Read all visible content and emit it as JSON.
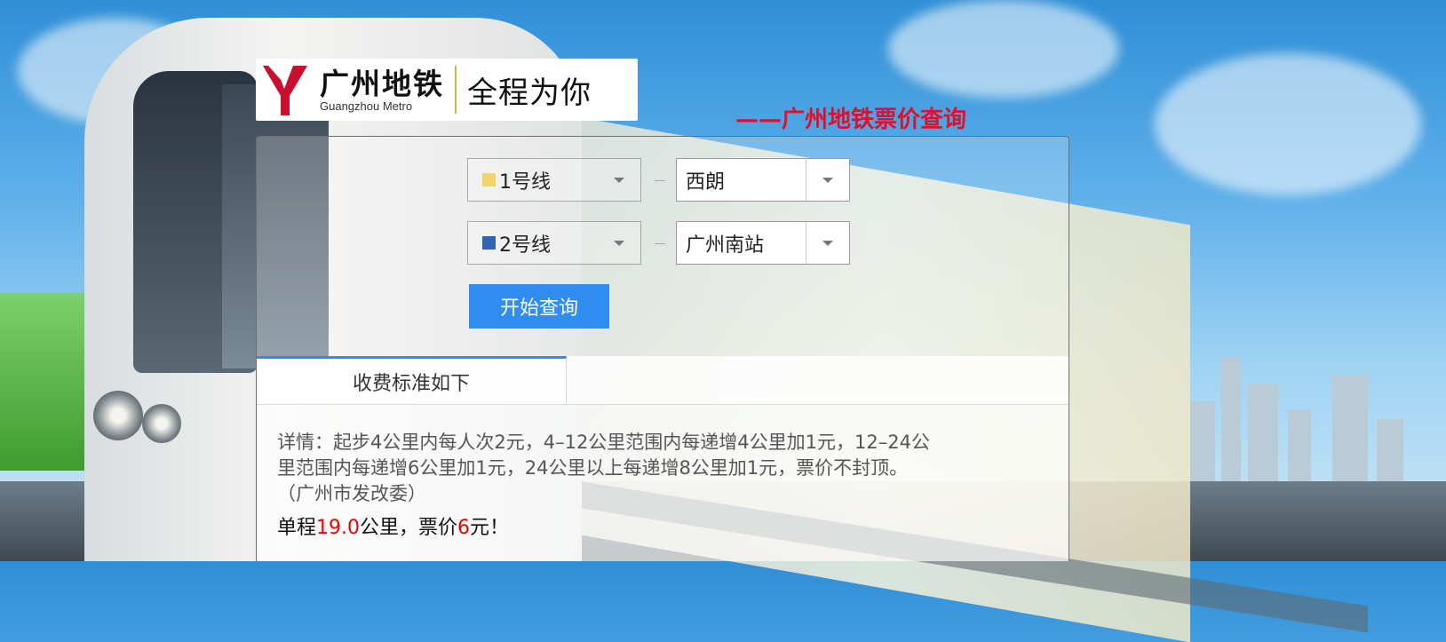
{
  "header": {
    "logo_cn": "广州地铁",
    "logo_en": "Guangzhou Metro",
    "slogan": "全程为你",
    "page_title": "——广州地铁票价查询"
  },
  "colors": {
    "line1": "#f0d36b",
    "line2": "#2f64b4",
    "accent": "#2f8cf0",
    "title_red": "#e0102a",
    "logo_red": "#c8102e"
  },
  "form": {
    "origin_line": "1号线",
    "origin_station": "西朗",
    "dest_line": "2号线",
    "dest_station": "广州南站",
    "query_button": "开始查询"
  },
  "tab": {
    "label": "收费标准如下"
  },
  "fare_info": {
    "detail_line1": "详情：起步4公里内每人次2元，4–12公里范围内每递增4公里加1元，12–24公",
    "detail_line2": "里范围内每递增6公里加1元，24公里以上每递增8公里加1元，票价不封顶。",
    "detail_line3": "（广州市发改委）",
    "result_prefix": "单程",
    "distance": "19.0",
    "result_mid": "公里，票价",
    "price": "6",
    "result_suffix": "元！"
  }
}
